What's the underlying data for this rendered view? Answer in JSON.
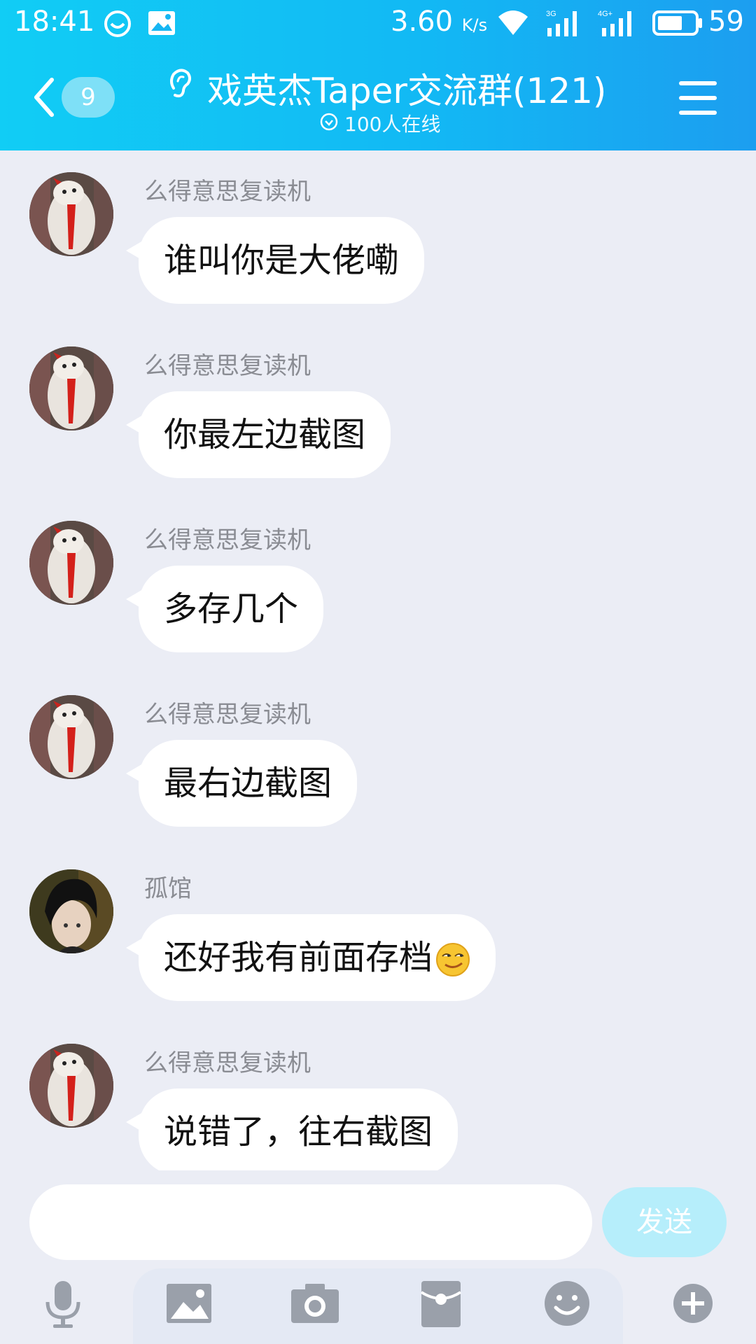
{
  "status_bar": {
    "time": "18:41",
    "network_speed": "3.60",
    "network_speed_unit": "K/s",
    "signal_1_label": "3G",
    "signal_2_label": "4G+",
    "battery": "59"
  },
  "header": {
    "unread_count": "9",
    "title": "戏英杰Taper交流群(121)",
    "online_status": "100人在线"
  },
  "messages": [
    {
      "sender": "么得意思复读机",
      "text": "谁叫你是大佬嘞",
      "avatar": "dog-avatar"
    },
    {
      "sender": "么得意思复读机",
      "text": "你最左边截图",
      "avatar": "dog-avatar"
    },
    {
      "sender": "么得意思复读机",
      "text": "多存几个",
      "avatar": "dog-avatar"
    },
    {
      "sender": "么得意思复读机",
      "text": "最右边截图",
      "avatar": "dog-avatar"
    },
    {
      "sender": "孤馆",
      "text": "还好我有前面存档",
      "avatar": "anime-boy-avatar",
      "emoji": "smirk-emoji"
    },
    {
      "sender": "么得意思复读机",
      "text": "说错了，往右截图",
      "avatar": "dog-avatar"
    }
  ],
  "composer": {
    "placeholder": "",
    "send_label": "发送"
  },
  "toolbar": {
    "icons": [
      "microphone-icon",
      "image-icon",
      "camera-icon",
      "red-packet-icon",
      "emoji-icon",
      "plus-icon"
    ]
  },
  "colors": {
    "header_gradient_start": "#11cdf5",
    "header_gradient_end": "#1c9ef0",
    "background": "#ebedf5",
    "bubble": "#ffffff",
    "send_button": "#b6eefb",
    "toolbar_icon": "#9aa0aa"
  }
}
